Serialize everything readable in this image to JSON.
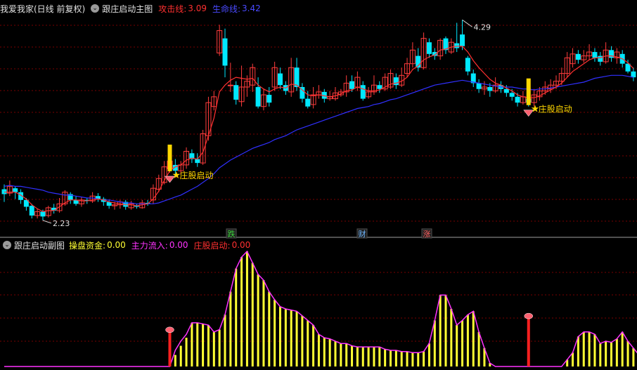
{
  "main_panel": {
    "stock_label": "我爱我家(日线 前复权)",
    "indicator_name": "跟庄启动主图",
    "attack_label": "攻击线:",
    "attack_value": "3.09",
    "lifeline_label": "生命线:",
    "lifeline_value": "3.42",
    "signal_label": "庄股启动",
    "high_label": "4.29",
    "low_label": "2.23",
    "event_tags": [
      {
        "text": "跌",
        "color": "#3cd43c"
      },
      {
        "text": "财",
        "color": "#6fb7ff"
      },
      {
        "text": "涨",
        "color": "#ff6060"
      }
    ]
  },
  "sub_panel": {
    "indicator_name": "跟庄启动副图",
    "fund_label": "操盘资金:",
    "fund_value": "0.00",
    "inflow_label": "主力流入:",
    "inflow_value": "0.00",
    "signal_label": "庄股启动:",
    "signal_value": "0.00"
  },
  "colors": {
    "bull": "#ff3c3c",
    "bear": "#00e8ff",
    "attack_line": "#ff3030",
    "lifeline": "#3030ff",
    "fund_bar": "#ffff33",
    "inflow_line": "#ff33ff",
    "signal_bar": "#ff2020",
    "grid": "#7a0000"
  },
  "chart_data": [
    {
      "type": "candlestick",
      "price_range": [
        2.15,
        4.35
      ],
      "candles": [
        [
          2.55,
          2.5,
          2.6,
          2.42
        ],
        [
          2.51,
          2.58,
          2.64,
          2.48
        ],
        [
          2.56,
          2.52,
          2.58,
          2.45
        ],
        [
          2.52,
          2.44,
          2.55,
          2.4
        ],
        [
          2.44,
          2.37,
          2.46,
          2.33
        ],
        [
          2.38,
          2.28,
          2.4,
          2.25
        ],
        [
          2.28,
          2.32,
          2.35,
          2.25
        ],
        [
          2.32,
          2.27,
          2.34,
          2.23
        ],
        [
          2.28,
          2.36,
          2.38,
          2.26
        ],
        [
          2.36,
          2.33,
          2.4,
          2.3
        ],
        [
          2.33,
          2.4,
          2.46,
          2.31
        ],
        [
          2.4,
          2.52,
          2.54,
          2.38
        ],
        [
          2.5,
          2.44,
          2.52,
          2.4
        ],
        [
          2.44,
          2.4,
          2.48,
          2.38
        ],
        [
          2.4,
          2.44,
          2.47,
          2.37
        ],
        [
          2.44,
          2.43,
          2.46,
          2.4
        ],
        [
          2.43,
          2.48,
          2.52,
          2.41
        ],
        [
          2.48,
          2.45,
          2.51,
          2.42
        ],
        [
          2.45,
          2.42,
          2.47,
          2.38
        ],
        [
          2.42,
          2.38,
          2.44,
          2.35
        ],
        [
          2.38,
          2.39,
          2.42,
          2.34
        ],
        [
          2.39,
          2.42,
          2.44,
          2.35
        ],
        [
          2.42,
          2.37,
          2.44,
          2.34
        ],
        [
          2.36,
          2.4,
          2.43,
          2.34
        ],
        [
          2.38,
          2.37,
          2.4,
          2.35
        ],
        [
          2.36,
          2.41,
          2.44,
          2.35
        ],
        [
          2.41,
          2.4,
          2.44,
          2.38
        ],
        [
          2.44,
          2.56,
          2.6,
          2.4
        ],
        [
          2.55,
          2.66,
          2.7,
          2.52
        ],
        [
          2.62,
          2.78,
          2.84,
          2.6
        ],
        [
          2.76,
          2.84,
          2.9,
          2.72
        ],
        [
          2.8,
          2.74,
          2.86,
          2.7
        ],
        [
          2.74,
          2.8,
          2.84,
          2.7
        ],
        [
          2.8,
          2.94,
          2.98,
          2.76
        ],
        [
          2.92,
          2.86,
          2.96,
          2.82
        ],
        [
          2.86,
          2.82,
          2.92,
          2.78
        ],
        [
          2.82,
          3.12,
          3.16,
          2.8
        ],
        [
          3.1,
          3.44,
          3.5,
          3.05
        ],
        [
          3.4,
          3.5,
          3.56,
          3.36
        ],
        [
          3.95,
          4.18,
          4.24,
          3.92
        ],
        [
          4.1,
          3.82,
          4.2,
          3.7
        ],
        [
          3.62,
          3.62,
          3.85,
          3.55
        ],
        [
          3.62,
          3.47,
          3.66,
          3.42
        ],
        [
          3.45,
          3.6,
          3.82,
          3.4
        ],
        [
          3.6,
          3.66,
          3.72,
          3.5
        ],
        [
          3.62,
          3.8,
          3.84,
          3.55
        ],
        [
          3.6,
          3.4,
          3.7,
          3.38
        ],
        [
          3.4,
          3.52,
          3.58,
          3.36
        ],
        [
          3.52,
          3.44,
          3.6,
          3.4
        ],
        [
          3.6,
          3.8,
          3.86,
          3.56
        ],
        [
          3.74,
          3.62,
          3.8,
          3.58
        ],
        [
          3.62,
          3.56,
          3.66,
          3.52
        ],
        [
          3.55,
          3.8,
          3.9,
          3.5
        ],
        [
          3.8,
          3.6,
          3.9,
          3.56
        ],
        [
          3.6,
          3.48,
          3.64,
          3.44
        ],
        [
          3.48,
          3.4,
          3.56,
          3.38
        ],
        [
          3.42,
          3.52,
          3.6,
          3.38
        ],
        [
          3.52,
          3.55,
          3.62,
          3.48
        ],
        [
          3.55,
          3.48,
          3.58,
          3.44
        ],
        [
          3.48,
          3.5,
          3.56,
          3.46
        ],
        [
          3.48,
          3.54,
          3.6,
          3.46
        ],
        [
          3.52,
          3.55,
          3.58,
          3.5
        ],
        [
          3.55,
          3.64,
          3.72,
          3.5
        ],
        [
          3.66,
          3.58,
          3.72,
          3.55
        ],
        [
          3.6,
          3.7,
          3.76,
          3.56
        ],
        [
          3.62,
          3.48,
          3.66,
          3.46
        ],
        [
          3.5,
          3.55,
          3.6,
          3.48
        ],
        [
          3.55,
          3.62,
          3.72,
          3.52
        ],
        [
          3.62,
          3.58,
          3.66,
          3.54
        ],
        [
          3.58,
          3.7,
          3.74,
          3.56
        ],
        [
          3.6,
          3.74,
          3.78,
          3.58
        ],
        [
          3.7,
          3.62,
          3.74,
          3.58
        ],
        [
          3.62,
          3.72,
          3.8,
          3.6
        ],
        [
          3.74,
          3.84,
          3.9,
          3.7
        ],
        [
          3.84,
          3.98,
          4.06,
          3.8
        ],
        [
          3.92,
          3.8,
          4.0,
          3.76
        ],
        [
          3.8,
          4.1,
          4.16,
          3.78
        ],
        [
          4.06,
          3.94,
          4.1,
          3.9
        ],
        [
          3.96,
          3.92,
          4.0,
          3.88
        ],
        [
          3.92,
          4.08,
          4.1,
          3.88
        ],
        [
          4.1,
          3.98,
          4.12,
          3.94
        ],
        [
          3.96,
          4.06,
          4.1,
          3.94
        ],
        [
          4.05,
          4.0,
          4.26,
          3.96
        ],
        [
          4.14,
          4.02,
          4.29,
          3.98
        ],
        [
          3.9,
          3.76,
          3.92,
          3.72
        ],
        [
          3.74,
          3.64,
          3.78,
          3.6
        ],
        [
          3.64,
          3.58,
          3.68,
          3.54
        ],
        [
          3.58,
          3.6,
          3.66,
          3.52
        ],
        [
          3.6,
          3.56,
          3.64,
          3.5
        ],
        [
          3.56,
          3.62,
          3.7,
          3.54
        ],
        [
          3.62,
          3.58,
          3.66,
          3.54
        ],
        [
          3.58,
          3.54,
          3.62,
          3.5
        ],
        [
          3.54,
          3.5,
          3.58,
          3.46
        ],
        [
          3.5,
          3.44,
          3.54,
          3.4
        ],
        [
          3.44,
          3.5,
          3.56,
          3.42
        ],
        [
          3.48,
          3.44,
          3.52,
          3.4
        ],
        [
          3.44,
          3.52,
          3.58,
          3.4
        ],
        [
          3.5,
          3.56,
          3.6,
          3.46
        ],
        [
          3.56,
          3.6,
          3.66,
          3.52
        ],
        [
          3.58,
          3.62,
          3.68,
          3.54
        ],
        [
          3.62,
          3.66,
          3.72,
          3.58
        ],
        [
          3.66,
          3.74,
          3.8,
          3.62
        ],
        [
          3.74,
          3.9,
          3.96,
          3.7
        ],
        [
          3.84,
          3.94,
          4.0,
          3.8
        ],
        [
          3.94,
          3.88,
          3.98,
          3.84
        ],
        [
          3.88,
          3.92,
          3.98,
          3.85
        ],
        [
          3.92,
          3.96,
          4.04,
          3.88
        ],
        [
          3.96,
          3.9,
          4.0,
          3.86
        ],
        [
          3.92,
          3.86,
          3.96,
          3.82
        ],
        [
          3.86,
          3.98,
          4.06,
          3.84
        ],
        [
          3.98,
          3.9,
          4.02,
          3.86
        ],
        [
          3.9,
          3.96,
          4.0,
          3.84
        ],
        [
          3.94,
          3.84,
          3.98,
          3.8
        ],
        [
          3.84,
          3.76,
          3.88,
          3.74
        ],
        [
          3.76,
          3.7,
          3.8,
          3.66
        ]
      ],
      "attack_line": [
        2.52,
        2.52,
        2.52,
        2.49,
        2.45,
        2.39,
        2.35,
        2.32,
        2.33,
        2.33,
        2.37,
        2.41,
        2.44,
        2.44,
        2.43,
        2.43,
        2.44,
        2.45,
        2.44,
        2.42,
        2.41,
        2.4,
        2.39,
        2.39,
        2.38,
        2.39,
        2.4,
        2.45,
        2.53,
        2.64,
        2.74,
        2.78,
        2.8,
        2.85,
        2.87,
        2.86,
        2.93,
        3.1,
        3.28,
        3.55,
        3.62,
        3.67,
        3.7,
        3.69,
        3.68,
        3.69,
        3.62,
        3.58,
        3.55,
        3.58,
        3.6,
        3.59,
        3.63,
        3.62,
        3.57,
        3.52,
        3.51,
        3.52,
        3.51,
        3.5,
        3.51,
        3.53,
        3.56,
        3.57,
        3.6,
        3.58,
        3.56,
        3.56,
        3.57,
        3.6,
        3.63,
        3.64,
        3.66,
        3.7,
        3.78,
        3.82,
        3.88,
        3.91,
        3.93,
        3.98,
        3.99,
        4.01,
        4.02,
        4.02,
        3.96,
        3.87,
        3.8,
        3.74,
        3.68,
        3.64,
        3.62,
        3.59,
        3.56,
        3.52,
        3.5,
        3.49,
        3.49,
        3.51,
        3.54,
        3.57,
        3.6,
        3.64,
        3.7,
        3.76,
        3.8,
        3.84,
        3.88,
        3.9,
        3.9,
        3.92,
        3.92,
        3.91,
        3.89,
        3.85,
        3.79
      ],
      "lifeline": [
        2.58,
        2.59,
        2.58,
        2.58,
        2.57,
        2.56,
        2.55,
        2.54,
        2.52,
        2.51,
        2.5,
        2.49,
        2.49,
        2.48,
        2.47,
        2.46,
        2.46,
        2.45,
        2.44,
        2.44,
        2.43,
        2.42,
        2.41,
        2.41,
        2.4,
        2.4,
        2.4,
        2.4,
        2.41,
        2.43,
        2.45,
        2.47,
        2.49,
        2.52,
        2.55,
        2.58,
        2.62,
        2.66,
        2.71,
        2.77,
        2.81,
        2.85,
        2.88,
        2.91,
        2.94,
        2.97,
        2.99,
        3.01,
        3.03,
        3.06,
        3.08,
        3.1,
        3.13,
        3.16,
        3.18,
        3.2,
        3.22,
        3.24,
        3.26,
        3.28,
        3.3,
        3.32,
        3.34,
        3.36,
        3.38,
        3.39,
        3.4,
        3.42,
        3.43,
        3.45,
        3.47,
        3.48,
        3.5,
        3.52,
        3.54,
        3.56,
        3.58,
        3.6,
        3.62,
        3.63,
        3.64,
        3.65,
        3.66,
        3.67,
        3.66,
        3.65,
        3.64,
        3.63,
        3.62,
        3.61,
        3.6,
        3.6,
        3.6,
        3.59,
        3.58,
        3.58,
        3.57,
        3.58,
        3.58,
        3.59,
        3.6,
        3.61,
        3.62,
        3.63,
        3.64,
        3.65,
        3.67,
        3.69,
        3.7,
        3.71,
        3.72,
        3.72,
        3.72,
        3.71,
        3.7
      ],
      "signals": [
        {
          "index": 30,
          "label": "庄股启动"
        },
        {
          "index": 95,
          "label": "庄股启动"
        }
      ]
    },
    {
      "type": "bar",
      "value_range": [
        0,
        100
      ],
      "fund": [
        0,
        0,
        0,
        0,
        0,
        0,
        0,
        0,
        0,
        0,
        0,
        0,
        0,
        0,
        0,
        0,
        0,
        0,
        0,
        0,
        0,
        0,
        0,
        0,
        0,
        0,
        0,
        0,
        0,
        0,
        0,
        10,
        18,
        25,
        38,
        38,
        37,
        36,
        30,
        32,
        45,
        65,
        85,
        95,
        100,
        90,
        80,
        75,
        65,
        58,
        52,
        50,
        49,
        48,
        44,
        40,
        36,
        28,
        25,
        24,
        22,
        20,
        20,
        18,
        17,
        17,
        17,
        17,
        17,
        15,
        14,
        14,
        13,
        13,
        12,
        12,
        13,
        20,
        40,
        62,
        62,
        50,
        36,
        40,
        45,
        48,
        30,
        16,
        3,
        0,
        0,
        0,
        0,
        0,
        0,
        0,
        0,
        0,
        0,
        0,
        0,
        0,
        6,
        12,
        26,
        30,
        30,
        28,
        20,
        22,
        21,
        24,
        30,
        22,
        16,
        10,
        9,
        5,
        4,
        2,
        2
      ],
      "inflow": [
        0,
        0,
        0,
        0,
        0,
        0,
        0,
        0,
        0,
        0,
        0,
        0,
        0,
        0,
        0,
        0,
        0,
        0,
        0,
        0,
        0,
        0,
        0,
        0,
        0,
        0,
        0,
        0,
        0,
        0,
        0,
        14,
        22,
        28,
        38,
        38,
        37,
        36,
        30,
        32,
        45,
        65,
        85,
        95,
        100,
        90,
        80,
        75,
        65,
        58,
        52,
        50,
        49,
        48,
        44,
        40,
        36,
        28,
        25,
        24,
        22,
        20,
        20,
        18,
        17,
        17,
        17,
        17,
        17,
        15,
        14,
        14,
        13,
        13,
        12,
        12,
        13,
        20,
        40,
        62,
        62,
        50,
        36,
        40,
        45,
        48,
        30,
        16,
        3,
        0,
        0,
        0,
        0,
        0,
        0,
        0,
        0,
        0,
        0,
        0,
        0,
        0,
        6,
        12,
        26,
        30,
        30,
        28,
        20,
        22,
        21,
        24,
        30,
        22,
        16,
        10,
        9,
        5,
        4,
        2,
        2
      ],
      "signal_bars": [
        {
          "index": 30,
          "value": 30
        },
        {
          "index": 95,
          "value": 42
        }
      ]
    }
  ]
}
